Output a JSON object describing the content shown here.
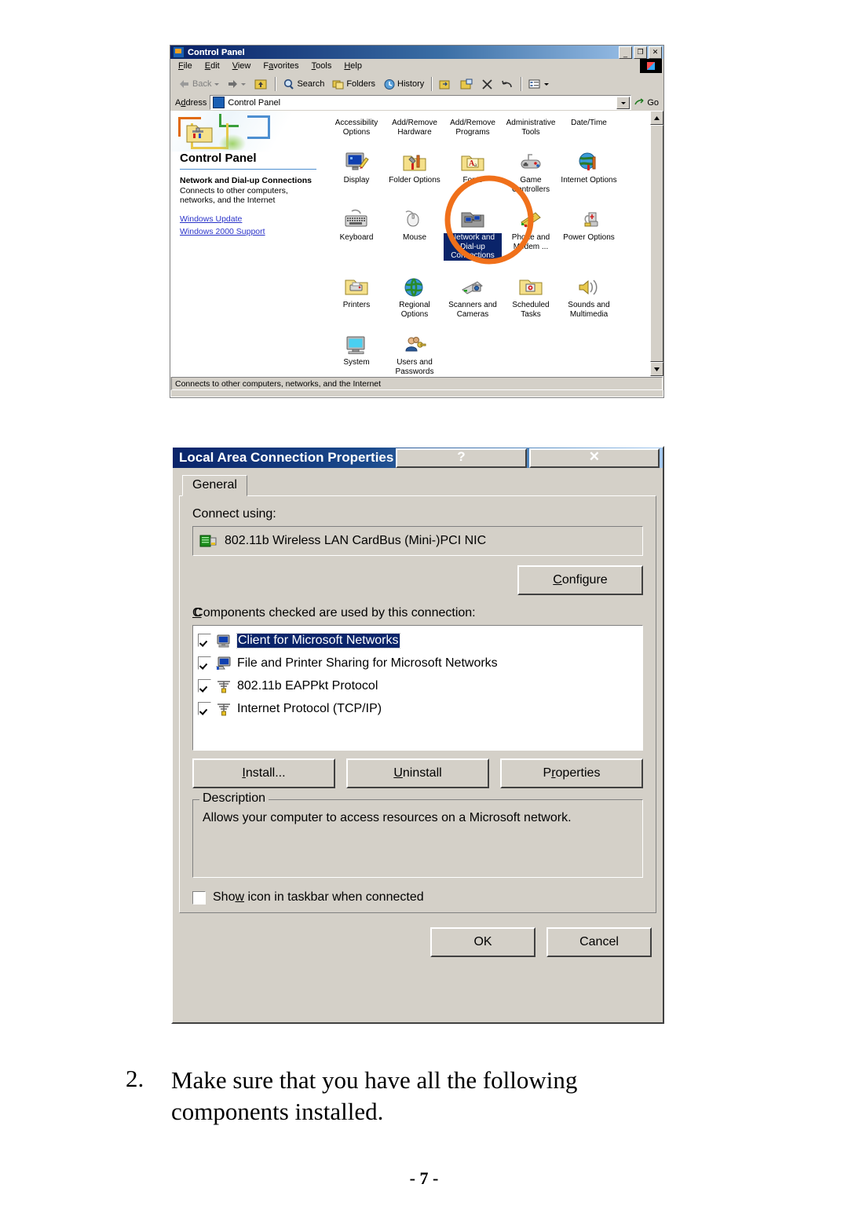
{
  "control_panel_window": {
    "title": "Control Panel",
    "title_icon": "control-panel-icon",
    "window_buttons": [
      {
        "name": "minimize-button",
        "glyph": "_"
      },
      {
        "name": "restore-button",
        "glyph": "❐"
      },
      {
        "name": "close-button",
        "glyph": "✕"
      }
    ],
    "menu": [
      {
        "label": "File",
        "accel": "F"
      },
      {
        "label": "Edit",
        "accel": "E"
      },
      {
        "label": "View",
        "accel": "V"
      },
      {
        "label": "Favorites",
        "accel": "a"
      },
      {
        "label": "Tools",
        "accel": "T"
      },
      {
        "label": "Help",
        "accel": "H"
      }
    ],
    "toolbar": [
      {
        "name": "back-button",
        "label": "Back",
        "icon": "left-arrow-icon",
        "disabled": true,
        "has_dropdown": true
      },
      {
        "name": "forward-button",
        "label": "",
        "icon": "right-arrow-icon",
        "disabled": true,
        "has_dropdown": true
      },
      {
        "name": "up-button",
        "label": "",
        "icon": "up-folder-icon",
        "disabled": false
      },
      {
        "name": "search-button",
        "label": "Search",
        "icon": "search-icon"
      },
      {
        "name": "folders-button",
        "label": "Folders",
        "icon": "folders-icon"
      },
      {
        "name": "history-button",
        "label": "History",
        "icon": "history-icon"
      },
      {
        "name": "move-to-button",
        "label": "",
        "icon": "move-to-folder-icon"
      },
      {
        "name": "copy-to-button",
        "label": "",
        "icon": "copy-to-folder-icon"
      },
      {
        "name": "delete-button",
        "label": "",
        "icon": "delete-x-icon"
      },
      {
        "name": "undo-button",
        "label": "",
        "icon": "undo-icon"
      },
      {
        "name": "views-button",
        "label": "",
        "icon": "views-icon",
        "has_dropdown": true
      }
    ],
    "address_bar": {
      "label": "Address",
      "label_accel": "d",
      "value": "Control Panel",
      "icon": "control-panel-icon",
      "go_label": "Go",
      "go_icon": "go-arrow-icon"
    },
    "sidebar": {
      "heading": "Control Panel",
      "selected_item_title": "Network and Dial-up Connections",
      "selected_item_desc": "Connects to other computers, networks, and the Internet",
      "links": [
        {
          "label": "Windows Update"
        },
        {
          "label": "Windows 2000 Support"
        }
      ]
    },
    "icons": [
      {
        "label": "Accessibility Options",
        "icon": "accessibility-icon",
        "selected": false
      },
      {
        "label": "Add/Remove Hardware",
        "icon": "add-remove-hardware-icon",
        "selected": false
      },
      {
        "label": "Add/Remove Programs",
        "icon": "add-remove-programs-icon",
        "selected": false
      },
      {
        "label": "Administrative Tools",
        "icon": "administrative-tools-icon",
        "selected": false
      },
      {
        "label": "Date/Time",
        "icon": "date-time-icon",
        "selected": false
      },
      {
        "label": "Display",
        "icon": "display-icon",
        "selected": false
      },
      {
        "label": "Folder Options",
        "icon": "folder-options-icon",
        "selected": false
      },
      {
        "label": "Fonts",
        "icon": "fonts-icon",
        "selected": false
      },
      {
        "label": "Game Controllers",
        "icon": "game-controllers-icon",
        "selected": false
      },
      {
        "label": "Internet Options",
        "icon": "internet-options-icon",
        "selected": false
      },
      {
        "label": "Keyboard",
        "icon": "keyboard-icon",
        "selected": false
      },
      {
        "label": "Mouse",
        "icon": "mouse-icon",
        "selected": false
      },
      {
        "label": "Network and Dial-up Connections",
        "icon": "network-connections-icon",
        "selected": true
      },
      {
        "label": "Phone and Modem ...",
        "icon": "phone-modem-icon",
        "selected": false
      },
      {
        "label": "Power Options",
        "icon": "power-options-icon",
        "selected": false
      },
      {
        "label": "Printers",
        "icon": "printers-icon",
        "selected": false
      },
      {
        "label": "Regional Options",
        "icon": "regional-options-icon",
        "selected": false
      },
      {
        "label": "Scanners and Cameras",
        "icon": "scanners-cameras-icon",
        "selected": false
      },
      {
        "label": "Scheduled Tasks",
        "icon": "scheduled-tasks-icon",
        "selected": false
      },
      {
        "label": "Sounds and Multimedia",
        "icon": "sounds-multimedia-icon",
        "selected": false
      },
      {
        "label": "System",
        "icon": "system-icon",
        "selected": false
      },
      {
        "label": "Users and Passwords",
        "icon": "users-passwords-icon",
        "selected": false
      }
    ],
    "status_text": "Connects to other computers, networks, and the Internet",
    "annotation": {
      "shape": "ellipse",
      "color": "#f0701a",
      "target": "network-connections-icon"
    }
  },
  "properties_dialog": {
    "title": "Local Area Connection Properties",
    "help_button": "?",
    "close_button": "✕",
    "tab": {
      "label": "General",
      "accel": ""
    },
    "connect_using_label": "Connect using:",
    "adapter": {
      "name": "802.11b Wireless LAN CardBus (Mini-)PCI NIC",
      "icon": "network-card-icon"
    },
    "configure_button": {
      "pre": "C",
      "accel": "C",
      "label": "onfigure",
      "full": "Configure"
    },
    "components_label": "Components checked are used by this connection:",
    "components": [
      {
        "label": "Client for Microsoft Networks",
        "checked": true,
        "selected": true,
        "icon": "client-computer-icon"
      },
      {
        "label": "File and Printer Sharing for Microsoft Networks",
        "checked": true,
        "selected": false,
        "icon": "file-sharing-icon"
      },
      {
        "label": "802.11b EAPPkt Protocol",
        "checked": true,
        "selected": false,
        "icon": "protocol-icon"
      },
      {
        "label": "Internet Protocol (TCP/IP)",
        "checked": true,
        "selected": false,
        "icon": "protocol-icon"
      }
    ],
    "action_buttons": [
      {
        "name": "install-button",
        "accel": "I",
        "rest": "nstall...",
        "full": "Install..."
      },
      {
        "name": "uninstall-button",
        "accel": "U",
        "rest": "ninstall",
        "full": "Uninstall"
      },
      {
        "name": "properties-button",
        "pre": "P",
        "accel": "r",
        "rest": "operties",
        "full": "Properties"
      }
    ],
    "description": {
      "legend": "Description",
      "text": "Allows your computer to access resources on a Microsoft network."
    },
    "taskbar_checkbox": {
      "label_pre": "Sho",
      "label_accel": "w",
      "label_rest": " icon in taskbar when connected",
      "full": "Show icon in taskbar when connected",
      "checked": false
    },
    "ok_button": "OK",
    "cancel_button": "Cancel"
  },
  "document": {
    "step_number": "2.",
    "step_text": "Make sure that you have all the following components installed.",
    "page_number": "- 7 -"
  }
}
